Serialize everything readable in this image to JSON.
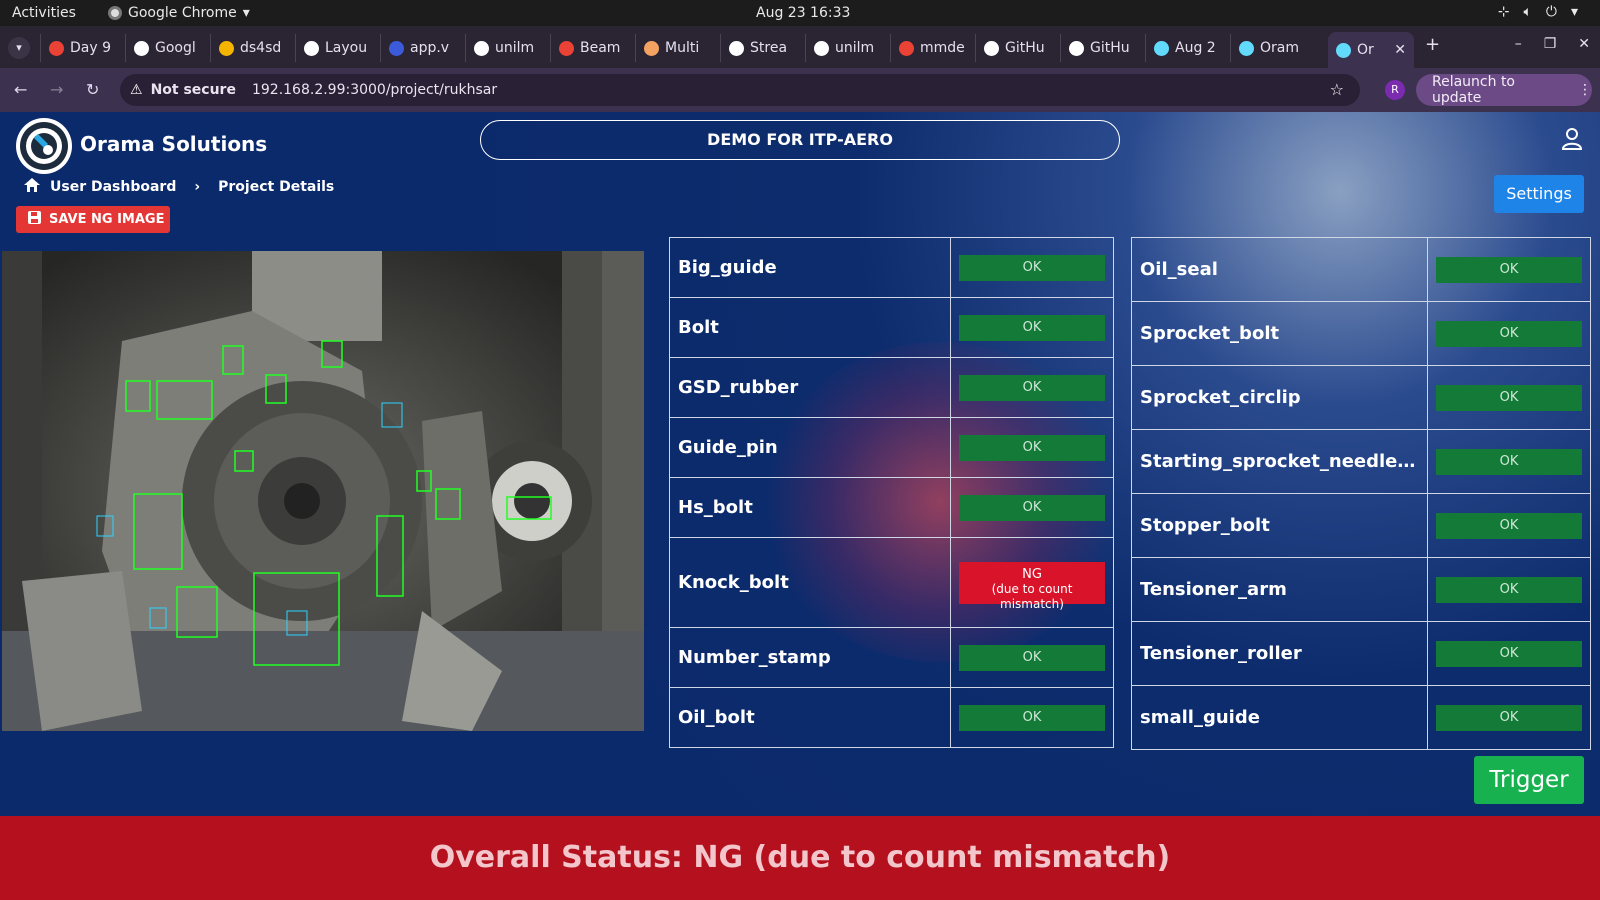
{
  "os_bar": {
    "activities": "Activities",
    "app_name": "Google Chrome",
    "datetime": "Aug 23  16:33"
  },
  "tabs": [
    {
      "label": "Day 9",
      "color": "#ea4335"
    },
    {
      "label": "Googl",
      "color": "#ffffff"
    },
    {
      "label": "ds4sd",
      "color": "#f4b400"
    },
    {
      "label": "Layou",
      "color": "#ffffff"
    },
    {
      "label": "app.v",
      "color": "#3b5bdb"
    },
    {
      "label": "unilm",
      "color": "#ffffff"
    },
    {
      "label": "Beam",
      "color": "#ea4335"
    },
    {
      "label": "Multi",
      "color": "#f4a261"
    },
    {
      "label": "Strea",
      "color": "#ffffff"
    },
    {
      "label": "unilm",
      "color": "#ffffff"
    },
    {
      "label": "mmde",
      "color": "#ea4335"
    },
    {
      "label": "GitHu",
      "color": "#ffffff"
    },
    {
      "label": "GitHu",
      "color": "#ffffff"
    },
    {
      "label": "Aug 2",
      "color": "#61dafb"
    },
    {
      "label": "Oram",
      "color": "#61dafb"
    },
    {
      "label": "Or",
      "color": "#61dafb",
      "active": true
    }
  ],
  "address_bar": {
    "security_label": "Not secure",
    "url": "192.168.2.99:3000/project/rukhsar",
    "profile_initial": "R",
    "relaunch_label": "Relaunch to update"
  },
  "header": {
    "brand": "Orama Solutions",
    "project_title": "DEMO FOR ITP-AERO"
  },
  "breadcrumb": {
    "home": "User Dashboard",
    "current": "Project Details"
  },
  "buttons": {
    "save_ng": "SAVE NG IMAGE",
    "settings": "Settings",
    "trigger": "Trigger"
  },
  "left_table": [
    {
      "name": "Big_guide",
      "status": "OK"
    },
    {
      "name": "Bolt",
      "status": "OK"
    },
    {
      "name": "GSD_rubber",
      "status": "OK"
    },
    {
      "name": "Guide_pin",
      "status": "OK"
    },
    {
      "name": "Hs_bolt",
      "status": "OK"
    },
    {
      "name": "Knock_bolt",
      "status": "NG",
      "note": "(due to count mismatch)"
    },
    {
      "name": "Number_stamp",
      "status": "OK"
    },
    {
      "name": "Oil_bolt",
      "status": "OK"
    }
  ],
  "right_table": [
    {
      "name": "Oil_seal",
      "status": "OK"
    },
    {
      "name": "Sprocket_bolt",
      "status": "OK"
    },
    {
      "name": "Sprocket_circlip",
      "status": "OK"
    },
    {
      "name": "Starting_sprocket_needle_circl...",
      "status": "OK"
    },
    {
      "name": "Stopper_bolt",
      "status": "OK"
    },
    {
      "name": "Tensioner_arm",
      "status": "OK"
    },
    {
      "name": "Tensioner_roller",
      "status": "OK"
    },
    {
      "name": "small_guide",
      "status": "OK"
    }
  ],
  "overall_status": "Overall Status: NG (due to count mismatch)",
  "colors": {
    "ok": "#137a38",
    "ng": "#d9142a",
    "banner": "#b4101e",
    "app_bg": "#0b2a6b"
  }
}
